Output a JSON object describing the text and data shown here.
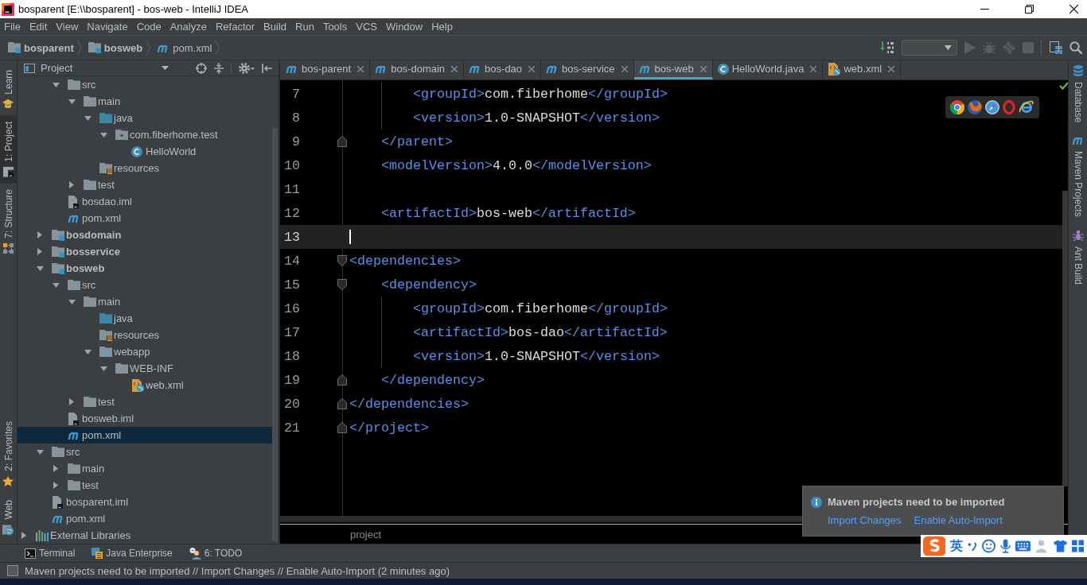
{
  "window": {
    "title": "bosparent [E:\\\\bosparent] - bos-web - IntelliJ IDEA"
  },
  "menu": [
    "File",
    "Edit",
    "View",
    "Navigate",
    "Code",
    "Analyze",
    "Refactor",
    "Build",
    "Run",
    "Tools",
    "VCS",
    "Window",
    "Help"
  ],
  "breadcrumbs": [
    {
      "label": "bosparent",
      "kind": "module"
    },
    {
      "label": "bosweb",
      "kind": "module"
    },
    {
      "label": "pom.xml",
      "kind": "maven"
    }
  ],
  "toolbar": [
    {
      "kind": "download",
      "disabled": false
    },
    {
      "kind": "select",
      "disabled": false
    },
    {
      "kind": "run",
      "disabled": true
    },
    {
      "kind": "debug",
      "disabled": true
    },
    {
      "kind": "coverage",
      "disabled": true
    },
    {
      "kind": "stop",
      "disabled": true
    },
    {
      "kind": "separator"
    },
    {
      "kind": "structure",
      "disabled": false
    },
    {
      "kind": "search",
      "disabled": false
    }
  ],
  "left_strip": {
    "top": [
      {
        "label": "Learn",
        "kind": "learn",
        "selected": false
      },
      {
        "label": "1: Project",
        "kind": "project",
        "selected": true
      },
      {
        "label": "7: Structure",
        "kind": "structure",
        "selected": false
      }
    ],
    "bottom": [
      {
        "label": "2: Favorites",
        "kind": "favorites",
        "selected": false
      },
      {
        "label": "Web",
        "kind": "web",
        "selected": false
      }
    ]
  },
  "project_panel": {
    "title": "Project",
    "tree": [
      {
        "children": [
          {
            "children": [
              {
                "label": "src",
                "kind": "folder",
                "expanded": true,
                "selected": false,
                "children": [
                  {
                    "label": "main",
                    "kind": "folder",
                    "expanded": true,
                    "selected": false,
                    "children": [
                      {
                        "label": "java",
                        "kind": "source-folder",
                        "expanded": true,
                        "selected": false,
                        "children": [
                          {
                            "label": "com.fiberhome.test",
                            "kind": "package",
                            "expanded": true,
                            "selected": false,
                            "children": [
                              {
                                "label": "HelloWorld",
                                "kind": "class",
                                "selected": false
                              }
                            ]
                          }
                        ]
                      },
                      {
                        "label": "resources",
                        "kind": "resources-folder",
                        "selected": false
                      }
                    ]
                  },
                  {
                    "label": "test",
                    "kind": "folder",
                    "expanded": false,
                    "selected": false
                  }
                ]
              },
              {
                "label": "bosdao.iml",
                "kind": "iml",
                "selected": false
              },
              {
                "label": "pom.xml",
                "kind": "maven",
                "selected": false
              }
            ]
          },
          {
            "label": "bosdomain",
            "kind": "module",
            "expanded": false,
            "selected": false
          },
          {
            "label": "bosservice",
            "kind": "module",
            "expanded": false,
            "selected": false
          },
          {
            "label": "bosweb",
            "kind": "module",
            "expanded": true,
            "selected": false,
            "children": [
              {
                "label": "src",
                "kind": "folder",
                "expanded": true,
                "selected": false,
                "children": [
                  {
                    "label": "main",
                    "kind": "folder",
                    "expanded": true,
                    "selected": false,
                    "children": [
                      {
                        "label": "java",
                        "kind": "source-folder",
                        "selected": false
                      },
                      {
                        "label": "resources",
                        "kind": "resources-folder",
                        "selected": false
                      },
                      {
                        "label": "webapp",
                        "kind": "web-folder",
                        "expanded": true,
                        "selected": false,
                        "children": [
                          {
                            "label": "WEB-INF",
                            "kind": "folder",
                            "expanded": true,
                            "selected": false,
                            "children": [
                              {
                                "label": "web.xml",
                                "kind": "web-xml",
                                "selected": false
                              }
                            ]
                          }
                        ]
                      }
                    ]
                  },
                  {
                    "label": "test",
                    "kind": "folder",
                    "expanded": false,
                    "selected": false
                  }
                ]
              },
              {
                "label": "bosweb.iml",
                "kind": "iml",
                "selected": false
              },
              {
                "label": "pom.xml",
                "kind": "maven",
                "selected": true
              }
            ]
          },
          {
            "label": "src",
            "kind": "folder",
            "expanded": true,
            "selected": false,
            "children": [
              {
                "label": "main",
                "kind": "folder",
                "expanded": false,
                "selected": false
              },
              {
                "label": "test",
                "kind": "folder",
                "expanded": false,
                "selected": false
              }
            ]
          },
          {
            "label": "bosparent.iml",
            "kind": "iml",
            "selected": false
          },
          {
            "label": "pom.xml",
            "kind": "maven",
            "selected": false
          }
        ]
      },
      {
        "label": "External Libraries",
        "kind": "libraries",
        "expanded": false,
        "selected": false
      }
    ]
  },
  "editor": {
    "tabs": [
      {
        "label": "bos-parent",
        "kind": "maven",
        "selected": false
      },
      {
        "label": "bos-domain",
        "kind": "maven",
        "selected": false
      },
      {
        "label": "bos-dao",
        "kind": "maven",
        "selected": false
      },
      {
        "label": "bos-service",
        "kind": "maven",
        "selected": false
      },
      {
        "label": "bos-web",
        "kind": "maven",
        "selected": true
      },
      {
        "label": "HelloWorld.java",
        "kind": "class",
        "selected": false
      },
      {
        "label": "web.xml",
        "kind": "web-xml",
        "selected": false
      }
    ],
    "lines": [
      {
        "number": "7",
        "text": "        <groupId>com.fiberhome</groupId>",
        "current": false,
        "fold_start": false,
        "fold_end": false
      },
      {
        "number": "8",
        "text": "        <version>1.0-SNAPSHOT</version>",
        "current": false,
        "fold_start": false,
        "fold_end": false
      },
      {
        "number": "9",
        "text": "    </parent>",
        "current": false,
        "fold_start": false,
        "fold_end": true
      },
      {
        "number": "10",
        "text": "    <modelVersion>4.0.0</modelVersion>",
        "current": false,
        "fold_start": false,
        "fold_end": false
      },
      {
        "number": "11",
        "current": false,
        "fold_start": false,
        "fold_end": false
      },
      {
        "number": "12",
        "text": "    <artifactId>bos-web</artifactId>",
        "current": false,
        "fold_start": false,
        "fold_end": false
      },
      {
        "number": "13",
        "current": true,
        "fold_start": false,
        "fold_end": false
      },
      {
        "number": "14",
        "text": "<dependencies>",
        "current": false,
        "fold_start": true,
        "fold_end": false
      },
      {
        "number": "15",
        "text": "    <dependency>",
        "current": false,
        "fold_start": true,
        "fold_end": false
      },
      {
        "number": "16",
        "text": "        <groupId>com.fiberhome</groupId>",
        "current": false,
        "fold_start": false,
        "fold_end": false
      },
      {
        "number": "17",
        "text": "        <artifactId>bos-dao</artifactId>",
        "current": false,
        "fold_start": false,
        "fold_end": false
      },
      {
        "number": "18",
        "text": "        <version>1.0-SNAPSHOT</version>",
        "current": false,
        "fold_start": false,
        "fold_end": false
      },
      {
        "number": "19",
        "text": "    </dependency>",
        "current": false,
        "fold_start": false,
        "fold_end": true
      },
      {
        "number": "20",
        "text": "</dependencies>",
        "current": false,
        "fold_start": false,
        "fold_end": true
      },
      {
        "number": "21",
        "text": "</project>",
        "current": false,
        "fold_start": false,
        "fold_end": true
      }
    ],
    "breadcrumb": "project"
  },
  "right_strip": [
    {
      "label": "Database",
      "kind": "database"
    },
    {
      "label": "Maven Projects",
      "kind": "maven"
    },
    {
      "label": "Ant Build",
      "kind": "ant"
    }
  ],
  "notification": {
    "title": "Maven projects need to be imported",
    "actions": [
      "Import Changes",
      "Enable Auto-Import"
    ]
  },
  "tool_windows": [
    {
      "label": "Terminal",
      "kind": "terminal"
    },
    {
      "label": "Java Enterprise",
      "kind": "enterprise"
    },
    {
      "label": "6: TODO",
      "kind": "todo"
    }
  ],
  "status_bar": {
    "message": "Maven projects need to be imported // Import Changes // Enable Auto-Import (2 minutes ago)"
  },
  "input_method": {
    "mode": "英"
  }
}
